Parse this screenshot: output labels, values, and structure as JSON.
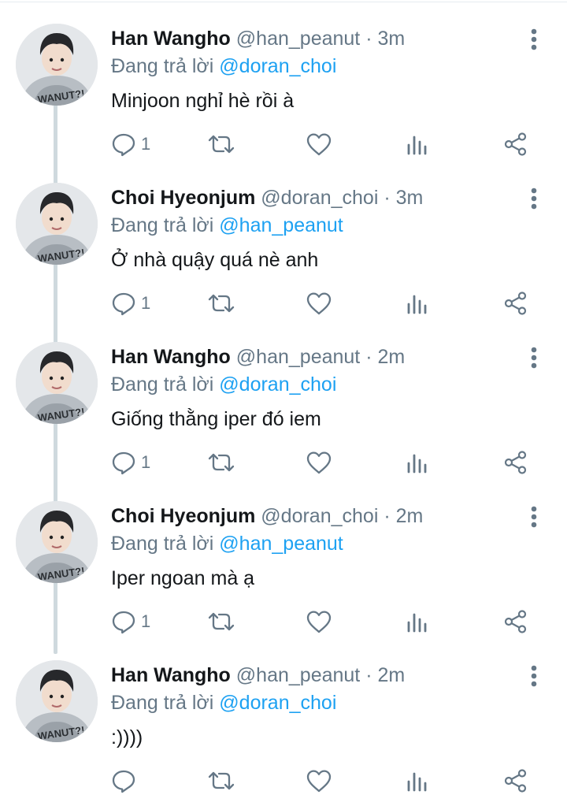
{
  "colors": {
    "text": "#14171a",
    "secondary": "#657786",
    "mention": "#1da1f2",
    "thread_line": "#cfd9de"
  },
  "tweets": [
    {
      "name": "Han Wangho",
      "handle": "@han_peanut",
      "separator": "·",
      "time": "3m",
      "reply_prefix": "Đang trả lời",
      "reply_to": "@doran_choi",
      "text": "Minjoon nghỉ hè rồi à",
      "reply_count": "1",
      "avatar_icon": "avatar-han-wangho"
    },
    {
      "name": "Choi Hyeonjum",
      "handle": "@doran_choi",
      "separator": "·",
      "time": "3m",
      "reply_prefix": "Đang trả lời",
      "reply_to": "@han_peanut",
      "text": "Ở nhà quậy quá nè anh",
      "reply_count": "1",
      "avatar_icon": "avatar-choi-hyeonjum"
    },
    {
      "name": "Han Wangho",
      "handle": "@han_peanut",
      "separator": "·",
      "time": "2m",
      "reply_prefix": "Đang trả lời",
      "reply_to": "@doran_choi",
      "text": "Giống thằng iper đó iem",
      "reply_count": "1",
      "avatar_icon": "avatar-han-wangho"
    },
    {
      "name": "Choi Hyeonjum",
      "handle": "@doran_choi",
      "separator": "·",
      "time": "2m",
      "reply_prefix": "Đang trả lời",
      "reply_to": "@han_peanut",
      "text": "Iper ngoan mà ạ",
      "reply_count": "1",
      "avatar_icon": "avatar-choi-hyeonjum"
    },
    {
      "name": "Han Wangho",
      "handle": "@han_peanut",
      "separator": "·",
      "time": "2m",
      "reply_prefix": "Đang trả lời",
      "reply_to": "@doran_choi",
      "text": ":))))",
      "reply_count": "",
      "avatar_icon": "avatar-han-wangho"
    }
  ]
}
